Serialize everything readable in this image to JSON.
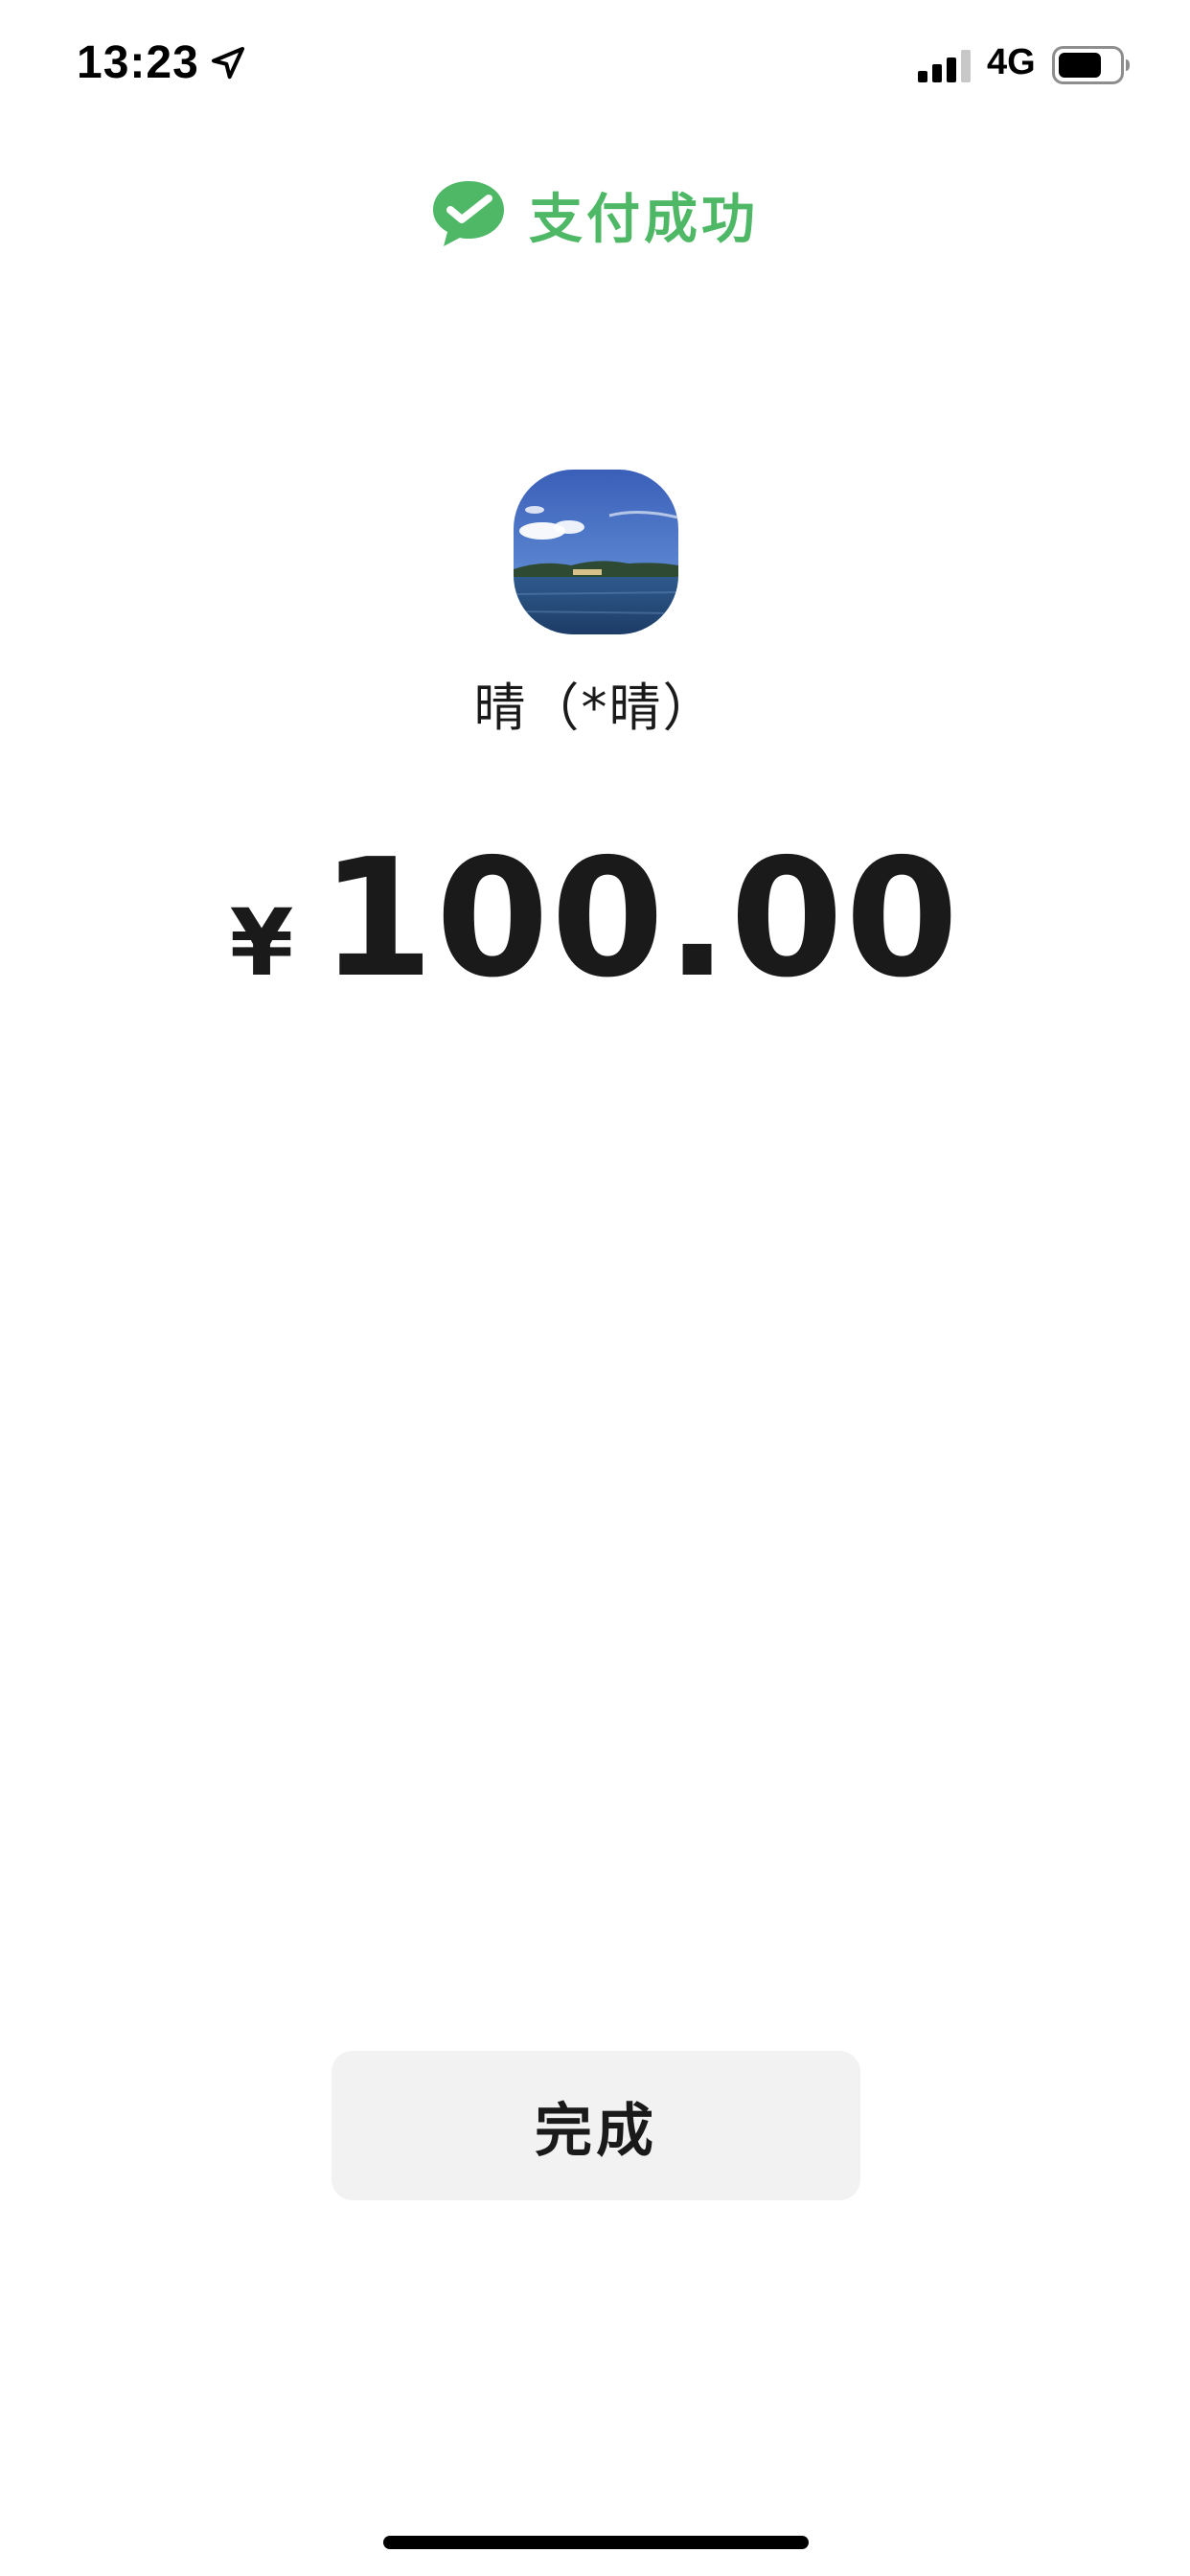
{
  "status_bar": {
    "time": "13:23",
    "network": "4G",
    "icons": [
      "location-arrow-icon",
      "signal-bars-icon",
      "battery-icon"
    ]
  },
  "header": {
    "title": "支付成功",
    "icon": "wechat-pay-icon",
    "accent_color": "#4fb866"
  },
  "payee": {
    "name": "晴（*晴）",
    "avatar": "landscape-photo-avatar"
  },
  "payment": {
    "currency_symbol": "¥",
    "amount": "100.00"
  },
  "actions": {
    "done_label": "完成",
    "button_color": "#f2f2f2"
  }
}
